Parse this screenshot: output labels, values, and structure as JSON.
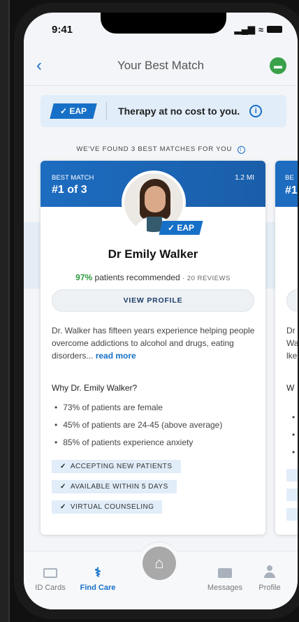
{
  "status_bar": {
    "time": "9:41"
  },
  "header": {
    "title": "Your Best Match"
  },
  "banner": {
    "badge": "✓ EAP",
    "text": "Therapy at no cost to you."
  },
  "matches_label": "WE'VE FOUND 3 BEST MATCHES FOR YOU",
  "match_card": {
    "best_label": "BEST MATCH",
    "rank": "#1 of 3",
    "distance": "1.2 MI",
    "badge": "✓ EAP",
    "name": "Dr Emily Walker",
    "recommend_pct": "97%",
    "recommend_text": "patients recommended",
    "reviews": "20 REVIEWS",
    "view_profile": "VIEW PROFILE",
    "bio": "Dr. Walker has fifteen years experience helping people overcome addictions to alcohol and drugs, eating disorders...",
    "read_more": "read more",
    "why_title": "Why Dr. Emily Walker?",
    "stats": [
      "73% of patients are female",
      "45% of patients are 24-45 (above average)",
      "85% of patients experience anxiety"
    ],
    "tags": [
      "ACCEPTING NEW PATIENTS",
      "AVAILABLE WITHIN 5 DAYS",
      "VIRTUAL COUNSELING"
    ]
  },
  "next_card_peek": {
    "best_label": "BE",
    "rank": "#1",
    "bio_lines": [
      "Dr",
      "Wa",
      "lke"
    ],
    "why": "W"
  },
  "nav": {
    "items": [
      {
        "label": "ID Cards",
        "icon": "id-card-icon",
        "active": false
      },
      {
        "label": "Find Care",
        "icon": "stethoscope-icon",
        "active": true
      },
      {
        "label": "Home",
        "icon": "home-icon",
        "active": false
      },
      {
        "label": "Messages",
        "icon": "envelope-icon",
        "active": false
      },
      {
        "label": "Profile",
        "icon": "person-icon",
        "active": false
      }
    ]
  },
  "colors": {
    "brand_blue": "#1670c7",
    "green": "#2e9a3e",
    "chat_green": "#3aa14a"
  }
}
